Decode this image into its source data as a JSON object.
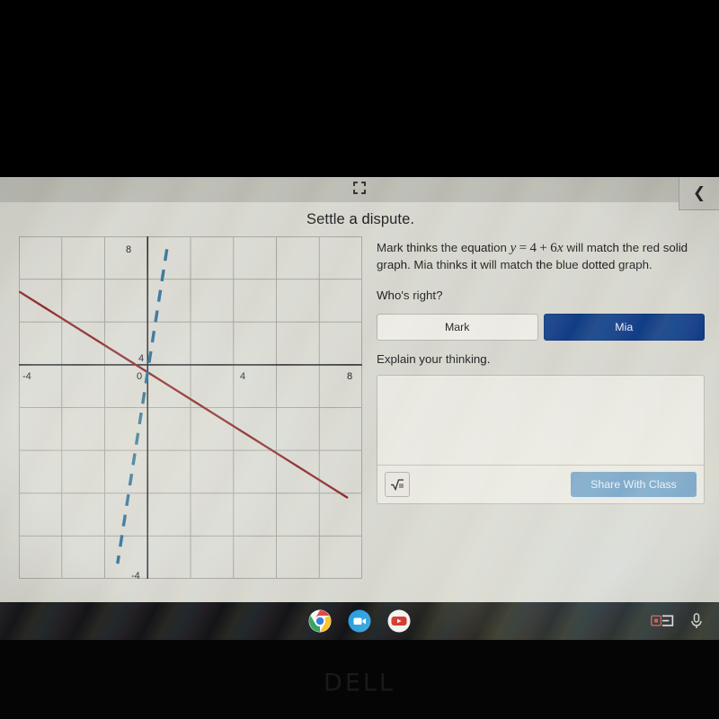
{
  "device": {
    "brand": "DELL"
  },
  "topbar": {
    "expand_icon": "fullscreen-expand-icon",
    "back_icon": "chevron-left-icon"
  },
  "activity": {
    "title": "Settle a dispute.",
    "prompt_part1": "Mark thinks the equation ",
    "equation": {
      "lhs": "y",
      "eq": "=",
      "rhs_const": "4",
      "plus": "+",
      "rhs_coef": "6",
      "rhs_var": "x"
    },
    "prompt_part2": " will match the red solid graph. Mia thinks it will match the blue dotted graph.",
    "question": "Who's right?",
    "choices": [
      {
        "label": "Mark",
        "selected": false
      },
      {
        "label": "Mia",
        "selected": true
      }
    ],
    "explain_label": "Explain your thinking.",
    "answer_value": "",
    "answer_placeholder": "",
    "math_button_icon": "square-root-icon",
    "share_label": "Share With Class"
  },
  "chart_data": {
    "type": "line",
    "title": "",
    "xlabel": "",
    "ylabel": "",
    "xlim": [
      -6,
      10
    ],
    "ylim": [
      -6,
      10
    ],
    "x_ticks": [
      -4,
      0,
      4,
      8
    ],
    "y_ticks": [
      8,
      4,
      -4
    ],
    "grid": true,
    "grid_step": 2,
    "legend": "none",
    "series": [
      {
        "name": "red solid graph",
        "style": "solid",
        "color": "#8f2626",
        "points": [
          [
            -5.2,
            6.6
          ],
          [
            9.3,
            -2.2
          ]
        ],
        "slope": -0.6,
        "intercept": 4
      },
      {
        "name": "blue dotted graph",
        "style": "dashed",
        "color": "#2f6f96",
        "points": [
          [
            0.9,
            9.4
          ],
          [
            -1.4,
            -5.3
          ]
        ],
        "slope": 6,
        "intercept": 4
      }
    ]
  },
  "shelf": {
    "apps": [
      {
        "name": "chrome-icon",
        "label": "Chrome"
      },
      {
        "name": "zoom-icon",
        "label": "Zoom"
      },
      {
        "name": "youtube-icon",
        "label": "YouTube"
      }
    ],
    "status": [
      {
        "name": "screen-capture-icon"
      },
      {
        "name": "microphone-icon"
      }
    ]
  }
}
